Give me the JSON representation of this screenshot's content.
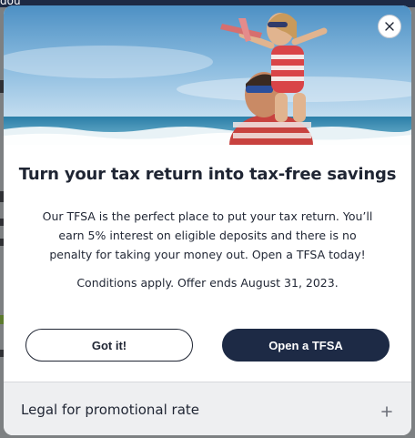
{
  "background_page": {
    "fragment_text": "dou"
  },
  "modal": {
    "hero_alt": "",
    "close_label": "Close",
    "title": "Turn your tax return into tax-free savings",
    "body": "Our TFSA is the perfect place to put your tax return. You’ll earn 5% interest on eligible deposits and there is no penalty for taking your money out. Open a TFSA today!",
    "conditions": "Conditions apply. Offer ends August 31, 2023.",
    "buttons": {
      "dismiss": "Got it!",
      "primary": "Open a TFSA"
    },
    "legal": {
      "label": "Legal for promotional rate",
      "expand_icon": "plus-icon"
    }
  },
  "colors": {
    "navy": "#1d2a45",
    "text": "#1f2533",
    "legal_bg": "#eeeff1",
    "overlay": "#7d8082"
  }
}
